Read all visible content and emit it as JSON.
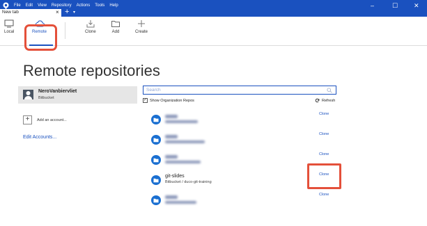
{
  "menu": [
    "File",
    "Edit",
    "View",
    "Repository",
    "Actions",
    "Tools",
    "Help"
  ],
  "tab": {
    "title": "New tab",
    "close": "×",
    "add": "+",
    "dropdown": "▾"
  },
  "window_controls": {
    "minimize": "–",
    "maximize": "☐",
    "close": "✕"
  },
  "toolbar": {
    "local": "Local",
    "remote": "Remote",
    "clone": "Clone",
    "add": "Add",
    "create": "Create"
  },
  "page_title": "Remote repositories",
  "account": {
    "name": "NeroVanbiervliet",
    "service": "Bitbucket"
  },
  "add_account": {
    "icon": "+",
    "label": "Add an account..."
  },
  "edit_accounts": "Edit Accounts...",
  "search": {
    "placeholder": "Search"
  },
  "show_org": {
    "checked": "✓",
    "label": "Show Organization Repos"
  },
  "refresh": "Refresh",
  "repos": [
    {
      "name": "",
      "path": "",
      "action": "Clone",
      "blurred": true
    },
    {
      "name": "",
      "path": "",
      "action": "Clone",
      "blurred": true
    },
    {
      "name": "",
      "path": "",
      "action": "Clone",
      "blurred": true
    },
    {
      "name": "git-slides",
      "path": "Bitbucket / duco-git-training",
      "action": "Clone",
      "blurred": false
    },
    {
      "name": "",
      "path": "",
      "action": "Clone",
      "blurred": true
    }
  ],
  "colors": {
    "accent": "#1a51bf",
    "highlight": "#e4503a",
    "repo_icon": "#1a6fd1"
  }
}
